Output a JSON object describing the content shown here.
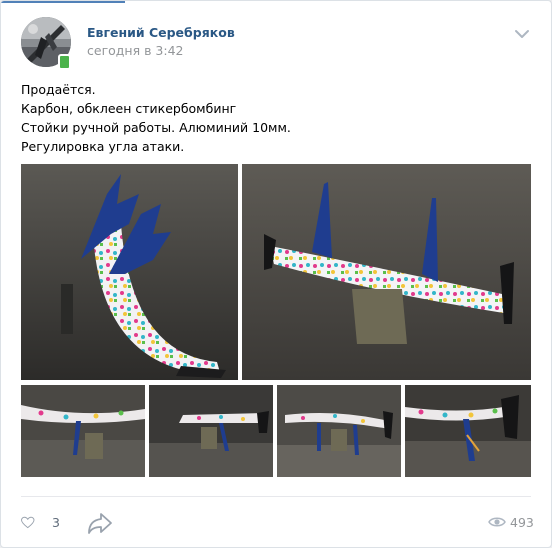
{
  "post": {
    "author": "Евгений Серебряков",
    "time": "сегодня в 3:42",
    "text_lines": [
      "Продаётся.",
      "Карбон, обклеен стикербомбинг",
      "Стойки ручной работы. Алюминий 10мм.",
      "Регулировка угла атаки."
    ],
    "photo_count": 6
  },
  "actions": {
    "likes": "3",
    "views": "493"
  },
  "icons": [
    "more-chevron-icon",
    "like-heart-icon",
    "share-arrow-icon",
    "views-eye-icon"
  ],
  "colors": {
    "accent": "#2a5885",
    "online": "#4bb34b",
    "muted": "#939699"
  }
}
